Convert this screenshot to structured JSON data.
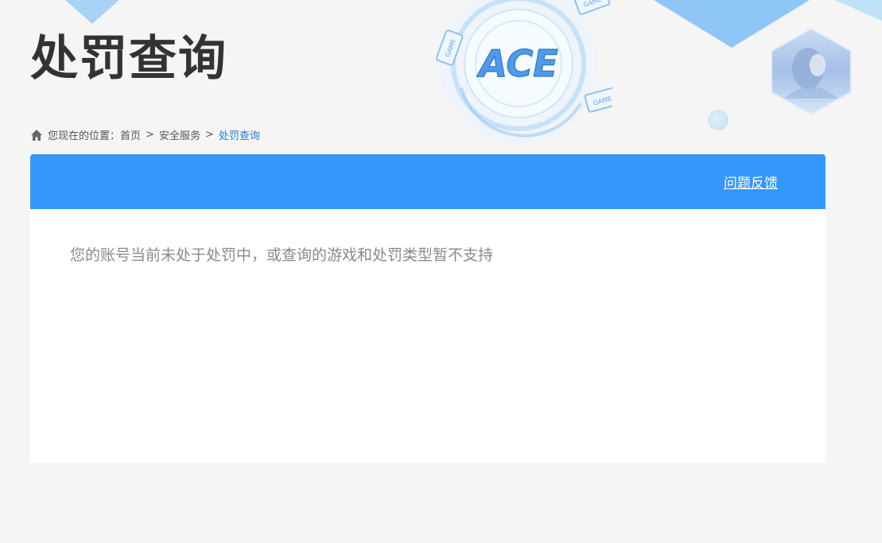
{
  "header": {
    "title": "处罚查询"
  },
  "breadcrumb": {
    "prefix": "您现在的位置：",
    "items": [
      "首页",
      "安全服务"
    ],
    "separator": ">",
    "current": "处罚查询"
  },
  "logo": {
    "text": "ACE",
    "badge_label": "GAME"
  },
  "panel": {
    "feedback_label": "问题反馈",
    "message": "您的账号当前未处于处罚中，或查询的游戏和处罚类型暂不支持"
  },
  "colors": {
    "accent": "#3497fb",
    "breadcrumb_current": "#1e7fd7",
    "title": "#333333",
    "message": "#8a8a8a"
  }
}
